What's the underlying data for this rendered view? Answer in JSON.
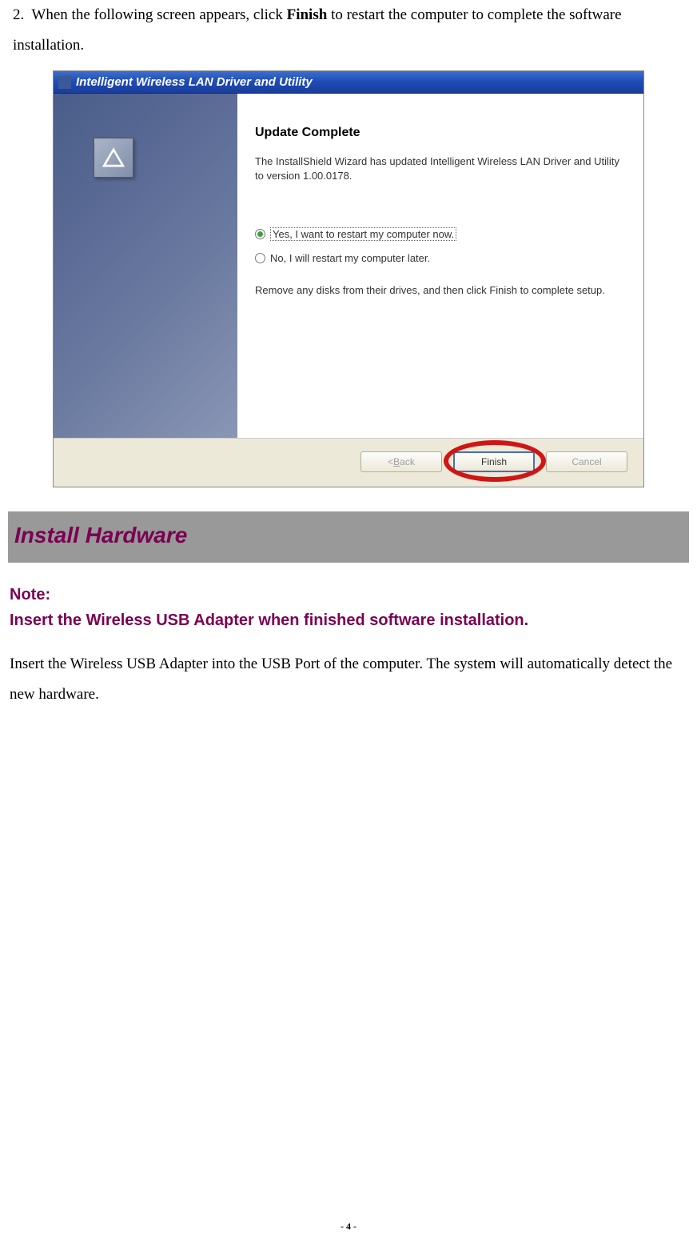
{
  "step": {
    "number": "2.",
    "text_before": "When the following screen appears, click ",
    "bold_word": "Finish",
    "text_after": " to restart the computer to complete the software installation."
  },
  "installer": {
    "title": "Intelligent Wireless LAN Driver and Utility",
    "heading": "Update Complete",
    "description": "The InstallShield Wizard has updated Intelligent Wireless LAN Driver and Utility to version 1.00.0178.",
    "radio_yes": "Yes, I want to restart my computer now.",
    "radio_no": "No, I will restart my computer later.",
    "remove_text": "Remove any disks from their drives, and then click Finish to complete setup.",
    "buttons": {
      "back_prefix": "< ",
      "back_key": "B",
      "back_rest": "ack",
      "finish": "Finish",
      "cancel": "Cancel"
    }
  },
  "section": {
    "heading": "Install Hardware",
    "note_label": "Note:",
    "note_text": "Insert the Wireless USB Adapter when finished software installation.",
    "body": "Insert the Wireless USB Adapter into the USB Port of the computer. The system will automatically detect the new hardware."
  },
  "page_number": {
    "prefix": "- ",
    "num": "4",
    "suffix": " -"
  }
}
